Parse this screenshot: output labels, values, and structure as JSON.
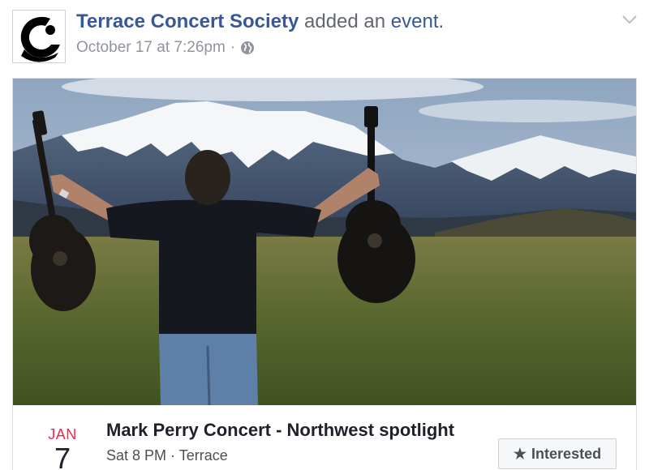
{
  "post": {
    "page_name": "Terrace Concert Society",
    "action_text": "added an",
    "action_link": "event.",
    "timestamp": "October 17 at 7:26pm",
    "separator": "·",
    "privacy_icon": "globe-icon",
    "menu_icon": "chevron-down-icon"
  },
  "event": {
    "month": "JAN",
    "day": "7",
    "title": "Mark Perry Concert - Northwest spotlight",
    "meta": "Sat 8 PM · Terrace",
    "interested_label": "Interested",
    "interested_icon": "star-icon"
  },
  "colors": {
    "link": "#365899",
    "month_red": "#f02849",
    "muted": "#90949c"
  }
}
